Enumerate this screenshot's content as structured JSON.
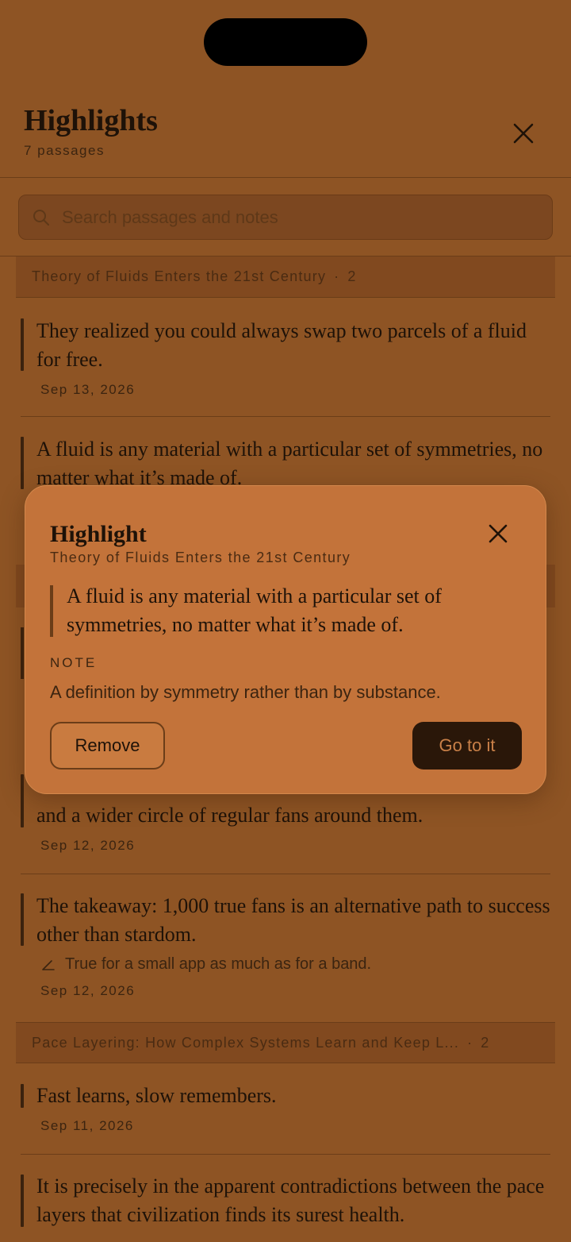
{
  "header": {
    "title": "Highlights",
    "subtitle": "7 passages"
  },
  "search": {
    "placeholder": "Search passages and notes"
  },
  "sections": [
    {
      "title": "Theory of Fluids Enters the 21st Century",
      "count": "2",
      "passages": [
        {
          "text": "They realized you could always swap two parcels of a fluid for free.",
          "date": "Sep 13, 2026"
        },
        {
          "text": "A fluid is any material with a particular set of symmetries, no matter what it’s made of."
        }
      ]
    },
    {
      "passages": [
        {
          "text": "and a wider circle of regular fans around them.",
          "date": "Sep 12, 2026"
        },
        {
          "text": "The takeaway: 1,000 true fans is an alternative path to success other than stardom.",
          "note": "True for a small app as much as for a band.",
          "date": "Sep 12, 2026"
        }
      ]
    },
    {
      "title": "Pace Layering: How Complex Systems Learn and Keep L...",
      "count": "2",
      "passages": [
        {
          "text": "Fast learns, slow remembers.",
          "date": "Sep 11, 2026"
        },
        {
          "text": "It is precisely in the apparent contradictions between the pace layers that civilization finds its surest health."
        }
      ]
    }
  ],
  "modal": {
    "title": "Highlight",
    "source": "Theory of Fluids Enters the 21st Century",
    "quote": "A fluid is any material with a particular set of symmetries, no matter what it’s made of.",
    "note_label": "NOTE",
    "note": "A definition by symmetry rather than by substance.",
    "remove_label": "Remove",
    "go_label": "Go to it"
  },
  "icons": {
    "close": "close-icon",
    "search": "search-icon",
    "pencil": "pencil-icon"
  },
  "colors": {
    "background": "#8e5424",
    "modal": "#c3733a",
    "primary_button": "#2a1709"
  }
}
